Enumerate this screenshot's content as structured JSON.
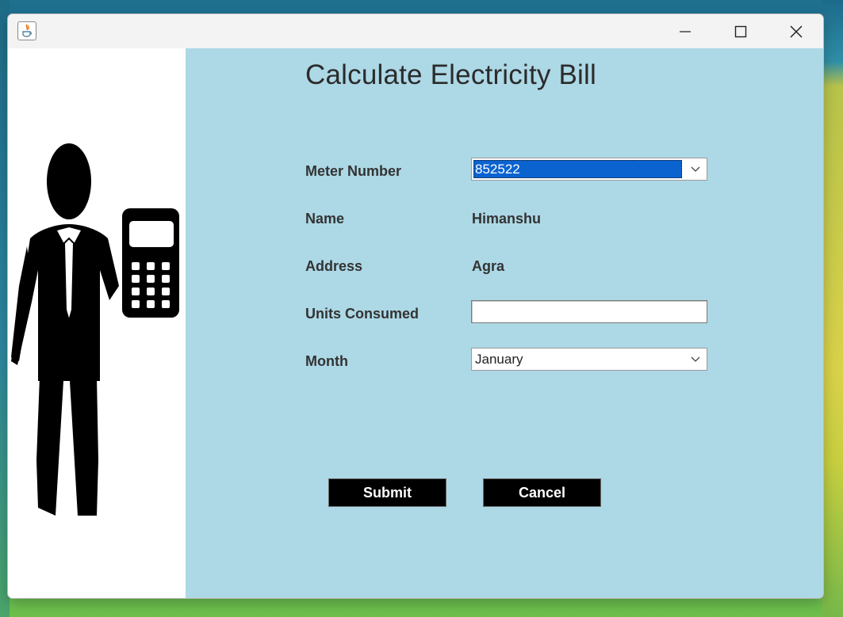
{
  "window": {
    "icon": "java-icon",
    "controls": [
      "minimize-icon",
      "maximize-icon",
      "close-icon"
    ]
  },
  "illustration": {
    "icon": "man-with-calculator-icon"
  },
  "form": {
    "heading": "Calculate Electricity Bill",
    "meter_label": "Meter Number",
    "meter_value": "852522",
    "name_label": "Name",
    "name_value": "Himanshu",
    "address_label": "Address",
    "address_value": "Agra",
    "units_label": "Units Consumed",
    "units_value": "",
    "month_label": "Month",
    "month_value": "January"
  },
  "buttons": {
    "submit": "Submit",
    "cancel": "Cancel"
  },
  "colors": {
    "form_background": "#add8e6",
    "button_background": "#000000",
    "selection": "#0b63d0"
  }
}
